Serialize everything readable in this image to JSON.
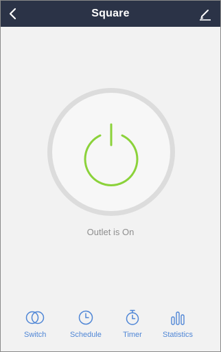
{
  "header": {
    "title": "Square",
    "back_icon": "chevron-left-icon",
    "edit_icon": "pencil-icon"
  },
  "power": {
    "state": "on",
    "accent_color": "#8bd23a",
    "status_text": "Outlet is On"
  },
  "tabs": [
    {
      "label": "Switch",
      "icon": "switch-icon"
    },
    {
      "label": "Schedule",
      "icon": "clock-icon"
    },
    {
      "label": "Timer",
      "icon": "stopwatch-icon"
    },
    {
      "label": "Statistics",
      "icon": "bar-chart-icon"
    }
  ],
  "colors": {
    "header_bg": "#2b3347",
    "page_bg": "#f2f2f2",
    "tab_color": "#4f86d6"
  }
}
